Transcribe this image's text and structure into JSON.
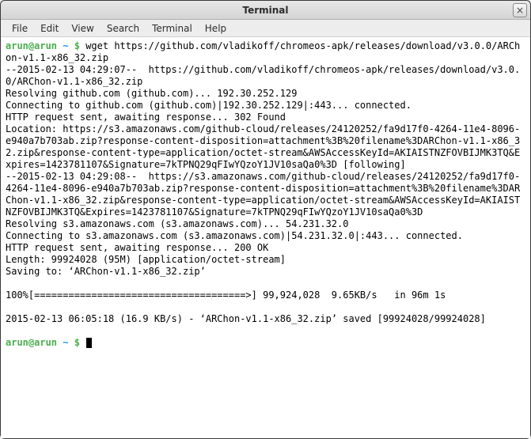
{
  "window": {
    "title": "Terminal",
    "close_label": "×"
  },
  "menubar": {
    "file": "File",
    "edit": "Edit",
    "view": "View",
    "search": "Search",
    "terminal": "Terminal",
    "help": "Help"
  },
  "prompt": {
    "user_host": "arun@arun",
    "cwd": "~",
    "symbol": "$"
  },
  "command": "wget https://github.com/vladikoff/chromeos-apk/releases/download/v3.0.0/ARChon-v1.1-x86_32.zip",
  "output_lines": [
    "--2015-02-13 04:29:07--  https://github.com/vladikoff/chromeos-apk/releases/download/v3.0.0/ARChon-v1.1-x86_32.zip",
    "Resolving github.com (github.com)... 192.30.252.129",
    "Connecting to github.com (github.com)|192.30.252.129|:443... connected.",
    "HTTP request sent, awaiting response... 302 Found",
    "Location: https://s3.amazonaws.com/github-cloud/releases/24120252/fa9d17f0-4264-11e4-8096-e940a7b703ab.zip?response-content-disposition=attachment%3B%20filename%3DARChon-v1.1-x86_32.zip&response-content-type=application/octet-stream&AWSAccessKeyId=AKIAISTNZFOVBIJMK3TQ&Expires=1423781107&Signature=7kTPNQ29qFIwYQzoY1JV10saQa0%3D [following]",
    "--2015-02-13 04:29:08--  https://s3.amazonaws.com/github-cloud/releases/24120252/fa9d17f0-4264-11e4-8096-e940a7b703ab.zip?response-content-disposition=attachment%3B%20filename%3DARChon-v1.1-x86_32.zip&response-content-type=application/octet-stream&AWSAccessKeyId=AKIAISTNZFOVBIJMK3TQ&Expires=1423781107&Signature=7kTPNQ29qFIwYQzoY1JV10saQa0%3D",
    "Resolving s3.amazonaws.com (s3.amazonaws.com)... 54.231.32.0",
    "Connecting to s3.amazonaws.com (s3.amazonaws.com)|54.231.32.0|:443... connected.",
    "HTTP request sent, awaiting response... 200 OK",
    "Length: 99924028 (95M) [application/octet-stream]",
    "Saving to: ‘ARChon-v1.1-x86_32.zip’",
    "",
    "100%[=====================================>] 99,924,028  9.65KB/s   in 96m 1s",
    "",
    "2015-02-13 06:05:18 (16.9 KB/s) - ‘ARChon-v1.1-x86_32.zip’ saved [99924028/99924028]",
    ""
  ]
}
